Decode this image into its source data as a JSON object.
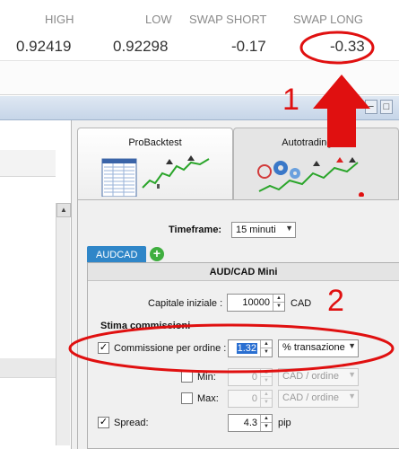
{
  "quote": {
    "headers": [
      "HIGH",
      "LOW",
      "SWAP SHORT",
      "SWAP LONG"
    ],
    "values": [
      "0.92419",
      "0.92298",
      "-0.17",
      "-0.33"
    ]
  },
  "window": {
    "controls": [
      "−",
      "□"
    ]
  },
  "tabs": [
    {
      "label": "ProBacktest"
    },
    {
      "label": "Autotrading Pro"
    }
  ],
  "timeframe": {
    "label": "Timeframe:",
    "value": "15 minuti"
  },
  "asset_tab": {
    "label": "AUDCAD",
    "add": "+"
  },
  "panel": {
    "title": "AUD/CAD Mini",
    "capital": {
      "label": "Capitale iniziale :",
      "value": "10000",
      "unit": "CAD"
    },
    "section": "Stima commissioni",
    "commission": {
      "label": "Commissione per ordine :",
      "value": "1.32",
      "mode": "% transazione",
      "checked": true
    },
    "min": {
      "label": "Min:",
      "value": "0",
      "unit": "CAD / ordine",
      "checked": false
    },
    "max": {
      "label": "Max:",
      "value": "0",
      "unit": "CAD / ordine",
      "checked": false
    },
    "spread": {
      "label": "Spread:",
      "value": "4.3",
      "unit": "pip",
      "checked": true
    }
  },
  "annotations": {
    "one": "1",
    "two": "2"
  },
  "colors": {
    "annotation": "#e01010",
    "tab_blue": "#2f86c8",
    "add_green": "#3fae3f"
  }
}
